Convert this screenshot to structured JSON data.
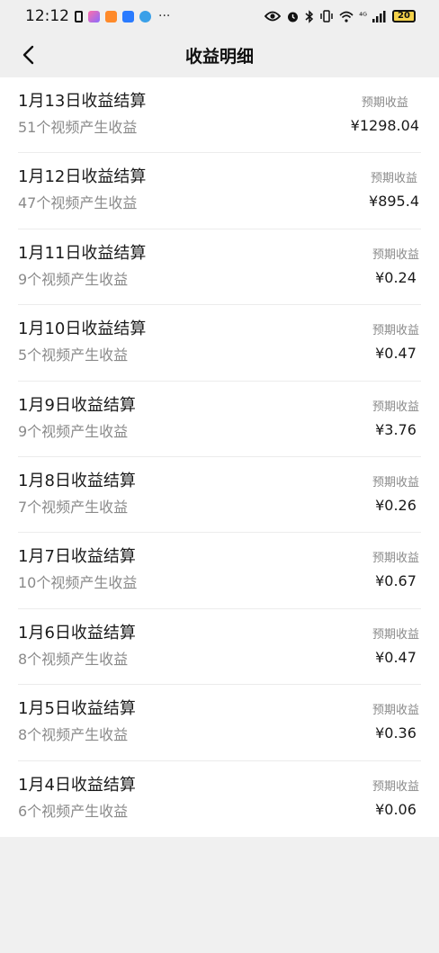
{
  "status_bar": {
    "time": "12:12",
    "dots": "···",
    "network": "⁴ᴳ",
    "battery": "20"
  },
  "header": {
    "title": "收益明细"
  },
  "list": [
    {
      "title": "1月13日收益结算",
      "subtitle": "51个视频产生收益",
      "label": "预期收益",
      "amount": "¥1298.04"
    },
    {
      "title": "1月12日收益结算",
      "subtitle": "47个视频产生收益",
      "label": "预期收益",
      "amount": "¥895.4"
    },
    {
      "title": "1月11日收益结算",
      "subtitle": "9个视频产生收益",
      "label": "预期收益",
      "amount": "¥0.24"
    },
    {
      "title": "1月10日收益结算",
      "subtitle": "5个视频产生收益",
      "label": "预期收益",
      "amount": "¥0.47"
    },
    {
      "title": "1月9日收益结算",
      "subtitle": "9个视频产生收益",
      "label": "预期收益",
      "amount": "¥3.76"
    },
    {
      "title": "1月8日收益结算",
      "subtitle": "7个视频产生收益",
      "label": "预期收益",
      "amount": "¥0.26"
    },
    {
      "title": "1月7日收益结算",
      "subtitle": "10个视频产生收益",
      "label": "预期收益",
      "amount": "¥0.67"
    },
    {
      "title": "1月6日收益结算",
      "subtitle": "8个视频产生收益",
      "label": "预期收益",
      "amount": "¥0.47"
    },
    {
      "title": "1月5日收益结算",
      "subtitle": "8个视频产生收益",
      "label": "预期收益",
      "amount": "¥0.36"
    },
    {
      "title": "1月4日收益结算",
      "subtitle": "6个视频产生收益",
      "label": "预期收益",
      "amount": "¥0.06"
    }
  ]
}
